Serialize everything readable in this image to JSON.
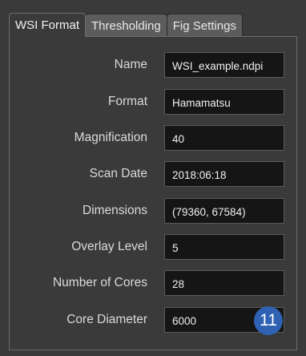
{
  "tabs": [
    {
      "label": "WSI Format",
      "active": true
    },
    {
      "label": "Thresholding",
      "active": false
    },
    {
      "label": "Fig Settings",
      "active": false
    }
  ],
  "fields": [
    {
      "label": "Name",
      "value": "WSI_example.ndpi"
    },
    {
      "label": "Format",
      "value": "Hamamatsu"
    },
    {
      "label": "Magnification",
      "value": "40"
    },
    {
      "label": "Scan Date",
      "value": "2018:06:18"
    },
    {
      "label": "Dimensions",
      "value": "(79360, 67584)"
    },
    {
      "label": "Overlay Level",
      "value": "5"
    },
    {
      "label": "Number of Cores",
      "value": "28"
    },
    {
      "label": "Core Diameter",
      "value": "6000"
    }
  ],
  "badge": {
    "text": "11",
    "color": "#2f62b3"
  },
  "colors": {
    "background": "#3a3a3a",
    "field_background": "#151515",
    "label_text": "#dadada"
  }
}
